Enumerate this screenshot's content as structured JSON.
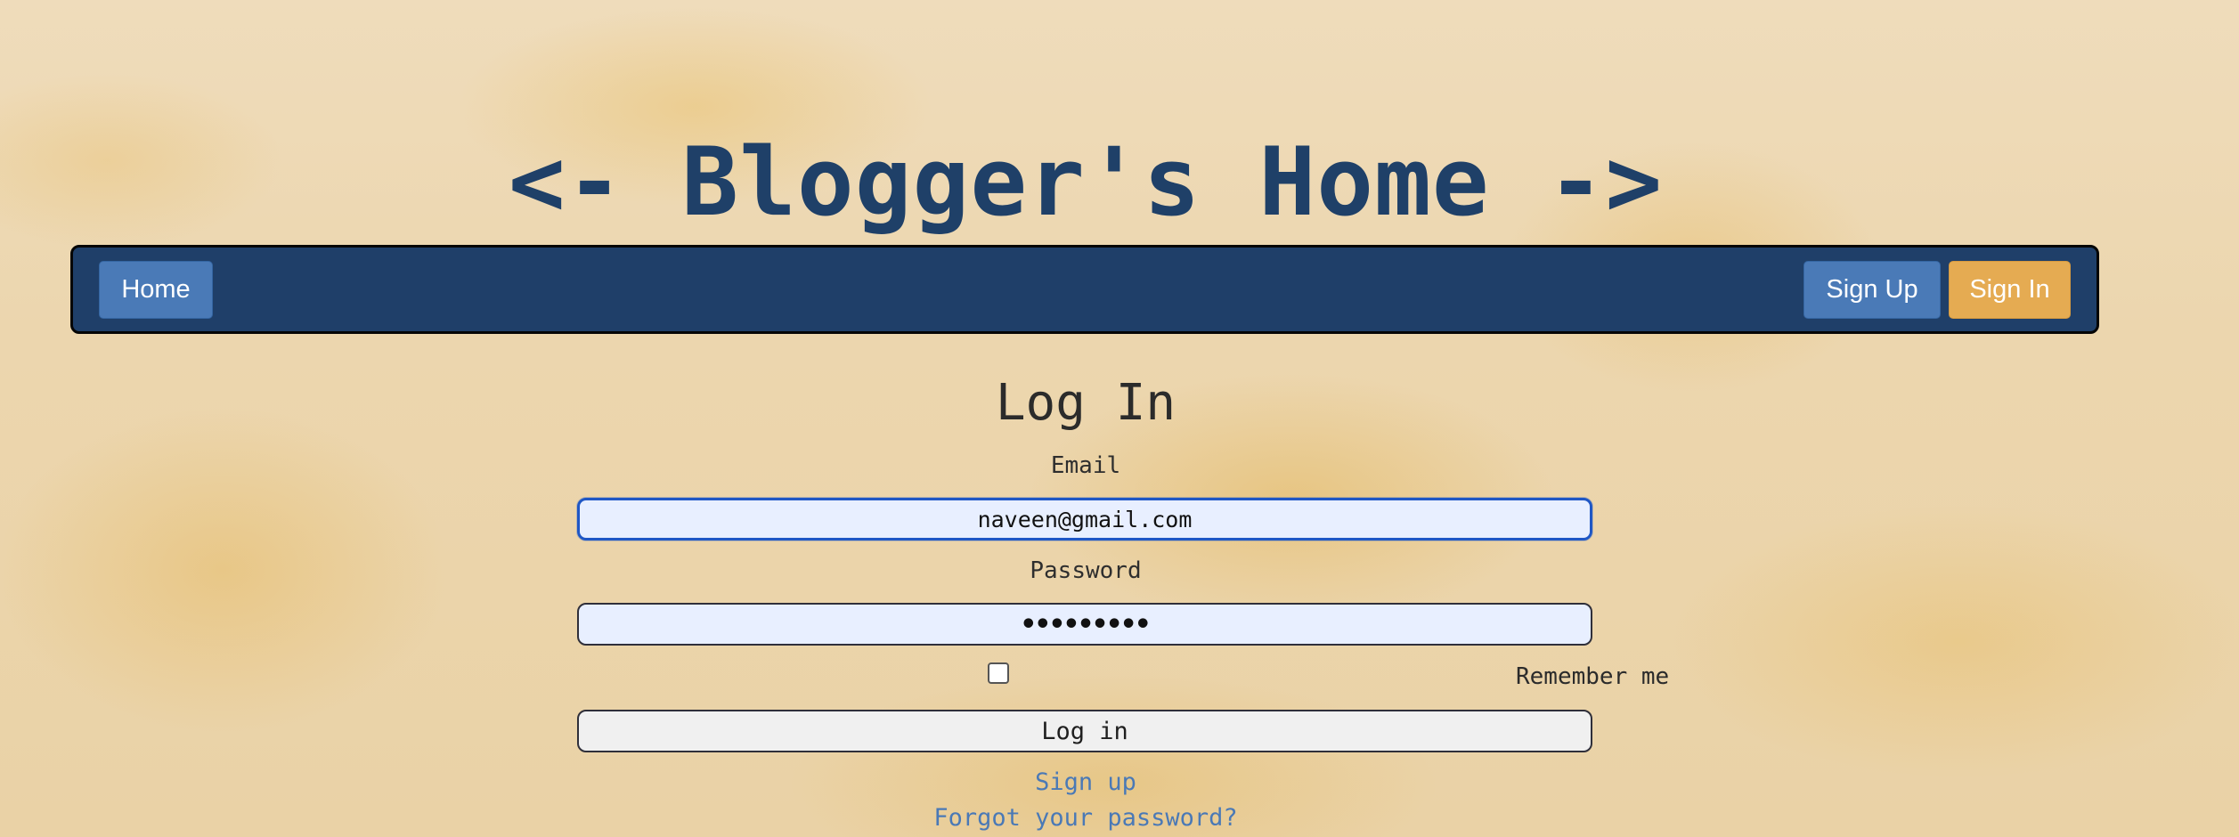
{
  "header": {
    "title": "<- Blogger's Home ->"
  },
  "navbar": {
    "home_label": "Home",
    "signup_label": "Sign Up",
    "signin_label": "Sign In"
  },
  "login_form": {
    "heading": "Log In",
    "email_label": "Email",
    "email_value": "naveen@gmail.com",
    "password_label": "Password",
    "password_value": "•••••••••",
    "remember_label": "Remember me",
    "remember_checked": false,
    "submit_label": "Log in"
  },
  "links": {
    "signup": "Sign up",
    "forgot_password": "Forgot your password?"
  },
  "colors": {
    "navbar_bg": "#1f3f69",
    "title": "#1f4068",
    "primary_button": "#4a7ab7",
    "signin_button": "#e5ab52",
    "link": "#4a79b6",
    "input_bg": "#e8efff",
    "focus_border": "#1f57c5"
  }
}
